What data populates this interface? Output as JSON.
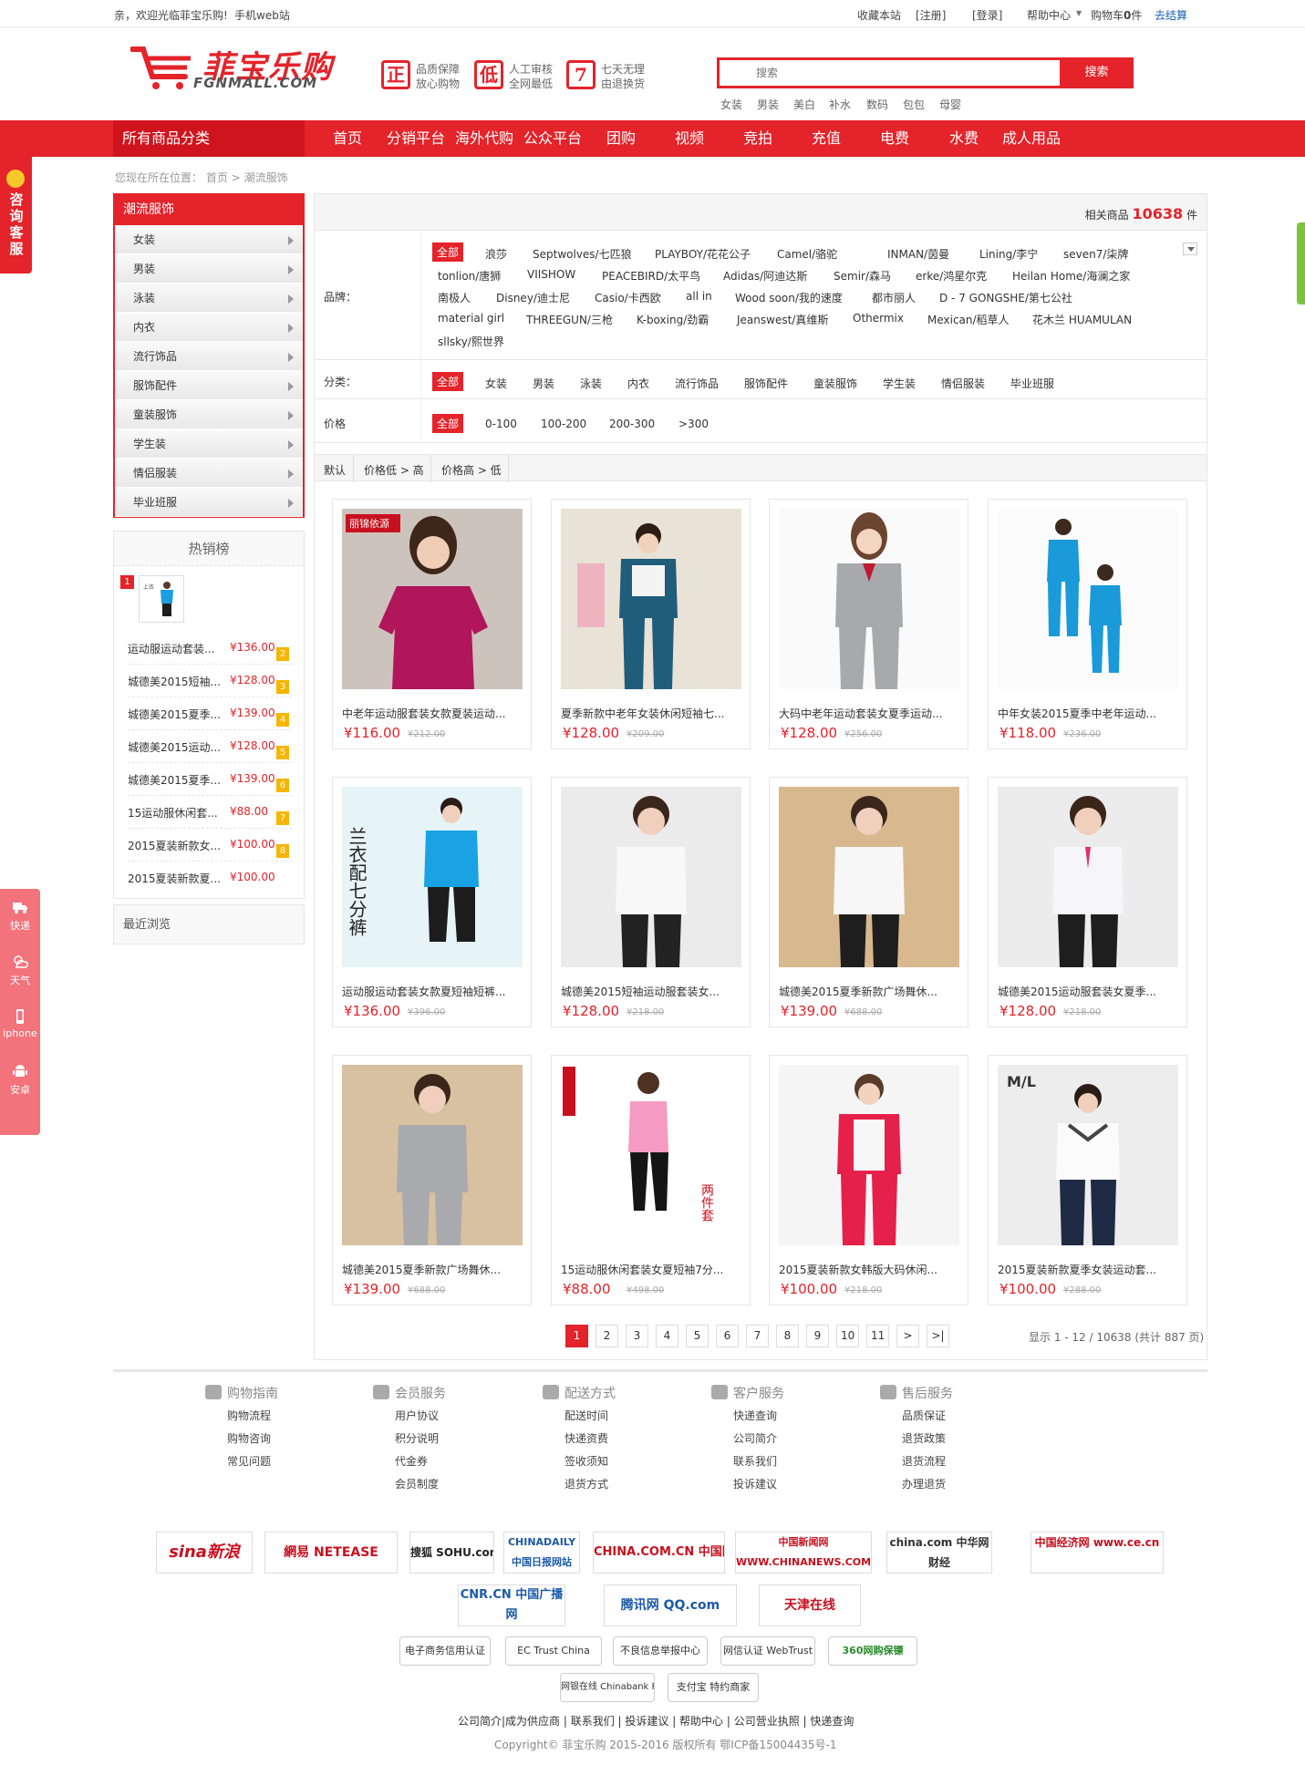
{
  "topbar": {
    "welcome": "亲，欢迎光临菲宝乐购!",
    "mobile_link": "手机web站",
    "favorite": "收藏本站",
    "register": "[注册]",
    "login": "[登录]",
    "help": "帮助中心",
    "cart_label": "购物车",
    "cart_count": "0",
    "cart_unit": "件",
    "checkout": "去结算"
  },
  "header": {
    "logo_cn": "菲宝乐购",
    "logo_en": "FGNMALL.COM",
    "promos": [
      {
        "badge": "正",
        "line1": "品质保障",
        "line2": "放心购物"
      },
      {
        "badge": "低",
        "line1": "人工审核",
        "line2": "全网最低"
      },
      {
        "badge": "7",
        "line1": "七天无理",
        "line2": "由退换货"
      }
    ],
    "search_placeholder": "搜索",
    "search_button": "搜索",
    "hot_words": [
      "女装",
      "男装",
      "美白",
      "补水",
      "数码",
      "包包",
      "母婴"
    ]
  },
  "nav": {
    "all_categories": "所有商品分类",
    "items": [
      "首页",
      "分销平台",
      "海外代购",
      "公众平台",
      "团购",
      "视频",
      "竞拍",
      "充值",
      "电费",
      "水费",
      "成人用品"
    ]
  },
  "floating": {
    "consult": "咨询客服",
    "tools": [
      "快递",
      "天气",
      "iphone",
      "安卓"
    ]
  },
  "breadcrumb": {
    "prefix": "您现在所在位置：",
    "home": "首页",
    "sep": ">",
    "current": "潮流服饰"
  },
  "category_panel": {
    "title": "潮流服饰",
    "items": [
      "女装",
      "男装",
      "泳装",
      "内衣",
      "流行饰品",
      "服饰配件",
      "童装服饰",
      "学生装",
      "情侣服装",
      "毕业班服"
    ]
  },
  "hot_panel": {
    "title": "热销榜",
    "first_rank": "1",
    "rows": [
      {
        "name": "运动服运动套装...",
        "price": "¥136.00",
        "rank": "2"
      },
      {
        "name": "城德美2015短袖...",
        "price": "¥128.00",
        "rank": "3"
      },
      {
        "name": "城德美2015夏季...",
        "price": "¥139.00",
        "rank": "4"
      },
      {
        "name": "城德美2015运动...",
        "price": "¥128.00",
        "rank": "5"
      },
      {
        "name": "城德美2015夏季...",
        "price": "¥139.00",
        "rank": "6"
      },
      {
        "name": "15运动服休闲套...",
        "price": "¥88.00",
        "rank": "7"
      },
      {
        "name": "2015夏装新款女...",
        "price": "¥100.00",
        "rank": "8"
      },
      {
        "name": "2015夏装新款夏...",
        "price": "¥100.00",
        "rank": ""
      }
    ]
  },
  "recent": {
    "title": "最近浏览"
  },
  "result": {
    "prefix": "相关商品",
    "count": "10638",
    "unit": "件"
  },
  "filters": {
    "brand_label": "品牌：",
    "brands": [
      "全部",
      "浪莎",
      "Septwolves/七匹狼",
      "PLAYBOY/花花公子",
      "Camel/骆驼",
      "INMAN/茵曼",
      "Lining/李宁",
      "seven7/柒牌",
      "tonlion/唐狮",
      "VIISHOW",
      "PEACEBIRD/太平鸟",
      "Adidas/阿迪达斯",
      "Semir/森马",
      "erke/鸿星尔克",
      "Heilan Home/海澜之家",
      "南极人",
      "Disney/迪士尼",
      "Casio/卡西欧",
      "all in",
      "Wood soon/我的速度",
      "都市丽人",
      "D - 7 GONGSHE/第七公社",
      "material girl",
      "THREEGUN/三枪",
      "K-boxing/劲霸",
      "Jeanswest/真维斯",
      "Othermix",
      "Mexican/稻草人",
      "花木兰 HUAMULAN",
      "sllsky/熙世界"
    ],
    "category_label": "分类：",
    "categories": [
      "全部",
      "女装",
      "男装",
      "泳装",
      "内衣",
      "流行饰品",
      "服饰配件",
      "童装服饰",
      "学生装",
      "情侣服装",
      "毕业班服"
    ],
    "price_label": "价格",
    "prices": [
      "全部",
      "0-100",
      "100-200",
      "200-300",
      ">300"
    ]
  },
  "sort": {
    "items": [
      "默认",
      "价格低 > 高",
      "价格高 > 低"
    ]
  },
  "products": [
    {
      "name": "中老年运动服套装女款夏装运动...",
      "price": "¥116.00",
      "old": "¥212.00",
      "img_text": "丽锦依源"
    },
    {
      "name": "夏季新款中老年女装休闲短袖七...",
      "price": "¥128.00",
      "old": "¥209.00",
      "img_text": ""
    },
    {
      "name": "大码中老年运动套装女夏季运动...",
      "price": "¥128.00",
      "old": "¥256.00",
      "img_text": ""
    },
    {
      "name": "中年女装2015夏季中老年运动...",
      "price": "¥118.00",
      "old": "¥236.00",
      "img_text": ""
    },
    {
      "name": "运动服运动套装女款夏短袖短裤...",
      "price": "¥136.00",
      "old": "¥396.00",
      "img_text": "兰衣配七分裤"
    },
    {
      "name": "城德美2015短袖运动服套装女...",
      "price": "¥128.00",
      "old": "¥218.00",
      "img_text": ""
    },
    {
      "name": "城德美2015夏季新款广场舞休...",
      "price": "¥139.00",
      "old": "¥688.00",
      "img_text": ""
    },
    {
      "name": "城德美2015运动服套装女夏季...",
      "price": "¥128.00",
      "old": "¥218.00",
      "img_text": ""
    },
    {
      "name": "城德美2015夏季新款广场舞休...",
      "price": "¥139.00",
      "old": "¥688.00",
      "img_text": ""
    },
    {
      "name": "15运动服休闲套装女夏短袖7分...",
      "price": "¥88.00",
      "old": "¥498.00",
      "img_text": "两件套"
    },
    {
      "name": "2015夏装新款女韩版大码休闲...",
      "price": "¥100.00",
      "old": "¥218.00",
      "img_text": ""
    },
    {
      "name": "2015夏装新款夏季女装运动套...",
      "price": "¥100.00",
      "old": "¥288.00",
      "img_text": "M/L"
    }
  ],
  "pagination": {
    "pages": [
      "1",
      "2",
      "3",
      "4",
      "5",
      "6",
      "7",
      "8",
      "9",
      "10",
      "11",
      ">",
      ">|"
    ],
    "current": "1",
    "info": "显示 1 - 12 / 10638 (共计 887 页)"
  },
  "footer": {
    "columns": [
      {
        "title": "购物指南",
        "items": [
          "购物流程",
          "购物咨询",
          "常见问题"
        ]
      },
      {
        "title": "会员服务",
        "items": [
          "用户协议",
          "积分说明",
          "代金券",
          "会员制度"
        ]
      },
      {
        "title": "配送方式",
        "items": [
          "配送时间",
          "快递资费",
          "签收须知",
          "退货方式"
        ]
      },
      {
        "title": "客户服务",
        "items": [
          "快递查询",
          "公司简介",
          "联系我们",
          "投诉建议"
        ]
      },
      {
        "title": "售后服务",
        "items": [
          "品质保证",
          "退货政策",
          "退货流程",
          "办理退货"
        ]
      }
    ],
    "partners": [
      "sina新浪",
      "網易 NETEASE",
      "搜狐 SOHU.com",
      "CHINADAILY 中国日报网站",
      "CHINA.COM.CN 中国网",
      "中国新闻网 WWW.CHINANEWS.COM",
      "china.com 中华网财经",
      "中国经济网 www.ce.cn",
      "CNR.CN 中国广播网",
      "腾讯网 QQ.com",
      "天津在线"
    ],
    "certs": [
      "电子商务信用认证",
      "EC Trust China",
      "不良信息举报中心",
      "网信认证 WebTrust",
      "360网购保镖",
      "网银在线 Chinabank Payment",
      "支付宝 特约商家"
    ],
    "links": "公司简介|成为供应商 | 联系我们 | 投诉建议 | 帮助中心 | 公司营业执照 | 快递查询",
    "copyright": "Copyright© 菲宝乐购 2015-2016 版权所有 鄂ICP备15004435号-1"
  },
  "colors": {
    "brand_red": "#e4232a",
    "nav_dark": "#d0141e",
    "rank_yellow": "#f7b500"
  }
}
